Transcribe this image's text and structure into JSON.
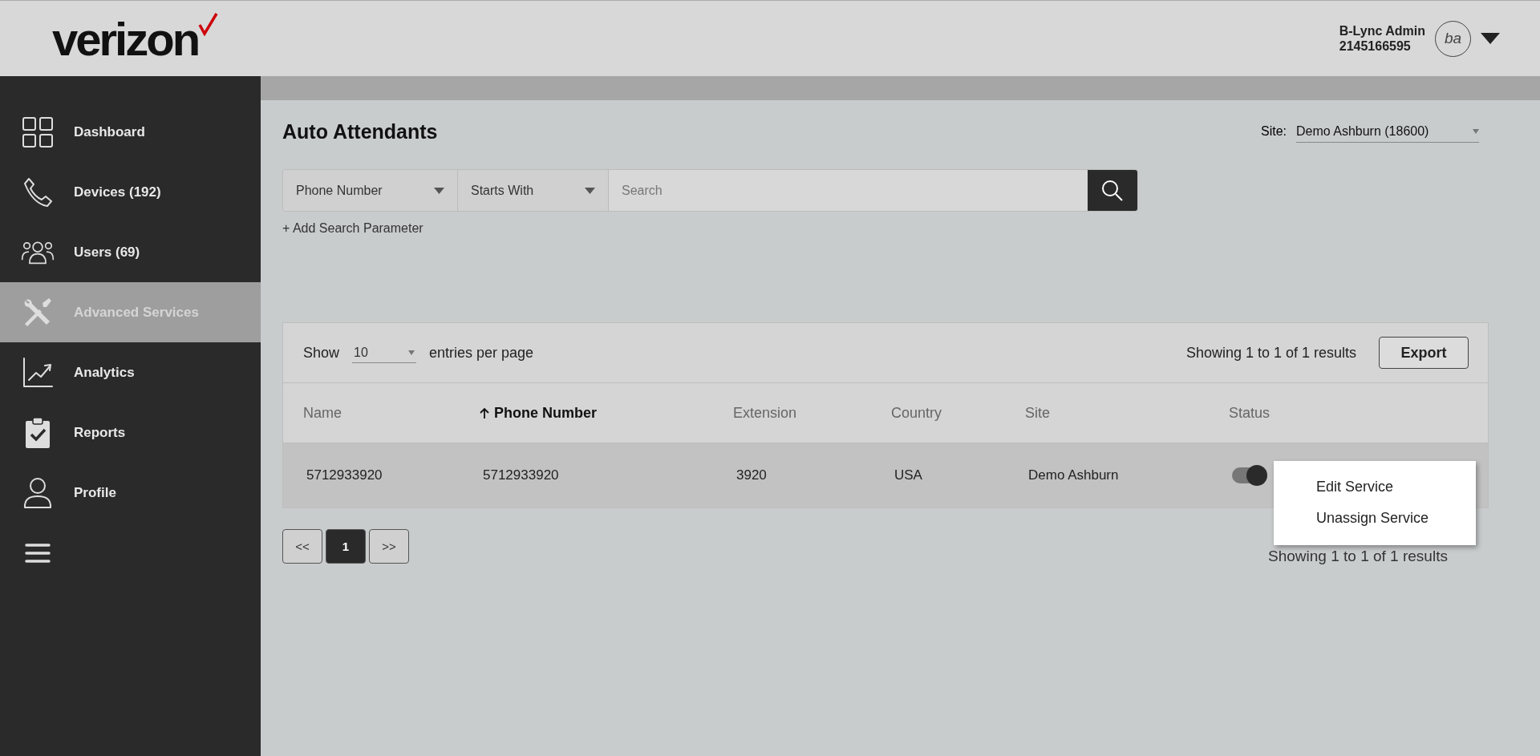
{
  "header": {
    "logo": "verizon",
    "user_name": "B-Lync Admin",
    "user_phone": "2145166595",
    "avatar_initials": "ba"
  },
  "sidebar": {
    "items": [
      {
        "label": "Dashboard",
        "kind": "grid",
        "selected": false
      },
      {
        "label": "Devices (192)",
        "kind": "phone",
        "selected": false
      },
      {
        "label": "Users (69)",
        "kind": "users",
        "selected": false
      },
      {
        "label": "Advanced Services",
        "kind": "tools",
        "selected": true
      },
      {
        "label": "Analytics",
        "kind": "chart",
        "selected": false
      },
      {
        "label": "Reports",
        "kind": "clipboard",
        "selected": false
      },
      {
        "label": "Profile",
        "kind": "person",
        "selected": false
      }
    ]
  },
  "page": {
    "title": "Auto Attendants",
    "site_label": "Site:",
    "site_value": "Demo Ashburn (18600)"
  },
  "search": {
    "field": "Phone Number",
    "operator": "Starts With",
    "placeholder": "Search",
    "add_parameter": "+ Add Search Parameter"
  },
  "table": {
    "show_label": "Show",
    "page_size": "10",
    "per_page_label": "entries per page",
    "summary": "Showing 1 to 1 of 1 results",
    "export": "Export",
    "columns": [
      {
        "label": "Name",
        "sorted": false
      },
      {
        "label": "Phone Number",
        "sorted": true
      },
      {
        "label": "Extension",
        "sorted": false
      },
      {
        "label": "Country",
        "sorted": false
      },
      {
        "label": "Site",
        "sorted": false
      },
      {
        "label": "Status",
        "sorted": false
      }
    ],
    "rows": [
      {
        "cells": [
          "5712933920",
          "5712933920",
          "3920",
          "USA",
          "Demo Ashburn"
        ],
        "on": true
      }
    ]
  },
  "pagination": {
    "first": "<<",
    "pages": [
      {
        "label": "1",
        "selected": true
      }
    ],
    "last": ">>"
  },
  "bottom_summary": "Showing 1 to 1 of 1 results",
  "menu": {
    "items": [
      "Edit Service",
      "Unassign Service"
    ]
  }
}
